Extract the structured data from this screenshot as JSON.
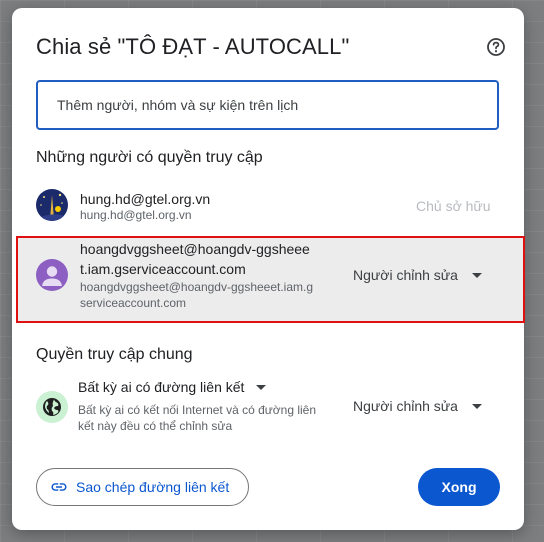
{
  "dialog": {
    "title": "Chia sẻ \"TÔ ĐẠT - AUTOCALL\"",
    "help_icon": "help-circle-icon"
  },
  "share_input": {
    "placeholder": "Thêm người, nhóm và sự kiện trên lịch",
    "value": ""
  },
  "people_section": {
    "heading": "Những người có quyền truy cập",
    "people": [
      {
        "name": "hung.hd@gtel.org.vn",
        "email": "hung.hd@gtel.org.vn",
        "role": "Chủ sở hữu"
      },
      {
        "name_line1": "hoangdvggsheet@hoangdv-ggsheee",
        "name_line2": "t.iam.gserviceaccount.com",
        "email_line1": "hoangdvggsheet@hoangdv-ggsheeet.iam.g",
        "email_line2": "serviceaccount.com",
        "role": "Người chỉnh sửa"
      }
    ]
  },
  "general_access": {
    "heading": "Quyền truy cập chung",
    "scope": "Bất kỳ ai có đường liên kết",
    "description_line1": "Bất kỳ ai có kết nối Internet và có đường liên",
    "description_line2": "kết này đều có thể chỉnh sửa",
    "role": "Người chỉnh sửa",
    "icon": "globe-icon"
  },
  "footer": {
    "copy_link_label": "Sao chép đường liên kết",
    "copy_link_icon": "link-icon",
    "done_label": "Xong"
  },
  "colors": {
    "accent": "#0b57d0",
    "highlight_border": "#e01010",
    "globe_bg": "#c9f1d2"
  }
}
